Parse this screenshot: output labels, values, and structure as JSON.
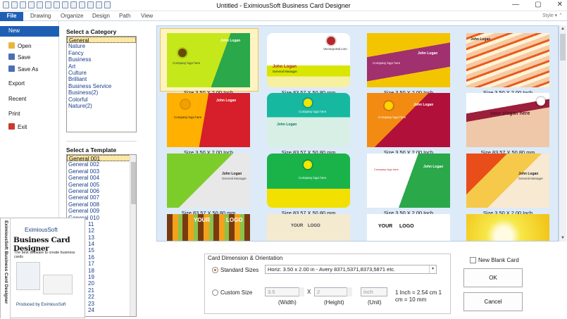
{
  "window": {
    "title": "Untitled - EximiousSoft Business Card Designer"
  },
  "ribbon": {
    "tabs": [
      "File",
      "Drawing",
      "Organize",
      "Design",
      "Path",
      "View"
    ],
    "style_label": "Style"
  },
  "file_menu": {
    "items": [
      "New",
      "Open",
      "Save",
      "Save As",
      "Export",
      "Recent",
      "Print",
      "Exit"
    ]
  },
  "categories": {
    "label": "Select a Category",
    "items": [
      "General",
      "Nature",
      "Fancy",
      "Business",
      "Art",
      "Culture",
      "Brilliant",
      "Business Service",
      "Business(2)",
      "Colorful",
      "Nature(2)"
    ],
    "selected": "General"
  },
  "templates": {
    "label": "Select a Template",
    "items": [
      "General 001",
      "General 002",
      "General 003",
      "General 004",
      "General 005",
      "General 006",
      "General 007",
      "General 008",
      "General 009",
      "General 010",
      "11",
      "12",
      "13",
      "14",
      "15",
      "16",
      "17",
      "18",
      "19",
      "20",
      "21",
      "22",
      "23",
      "24"
    ],
    "selected": "General 001"
  },
  "gallery": {
    "captions": [
      "Size 3.50 X 2.00 Inch",
      "Size 83.57 X 50.80 mm",
      "Size 3.50 X 2.00 Inch",
      "Size 3.50 X 2.00 Inch",
      "Size 3.50 X 2.00 Inch",
      "Size 83.57 X 50.80 mm",
      "Size 3.50 X 2.00 Inch",
      "Size 83.57 X 50.80 mm",
      "Size 83.57 X 50.80 mm",
      "Size 83.57 X 50.80 mm",
      "Size 3.50 X 2.00 Inch",
      "Size 3.50 X 2.00 Inch"
    ],
    "card_text": {
      "name": "John Logan",
      "role": "General Manager",
      "company": "Company logo here",
      "slogan": "your slogan here",
      "site": "Vectorportal.com",
      "your_logo": "YOUR",
      "logo": "LOGO"
    }
  },
  "options": {
    "group_title": "Card Dimension & Orientation",
    "standard_label": "Standard Sizes",
    "standard_value": "Horiz: 3.50 x 2.00 in - Avery 8371,5371,8373,5871 etc.",
    "custom_label": "Custom Size",
    "width_value": "3.5",
    "height_value": "2",
    "unit_value": "inch",
    "x_label": "X",
    "width_label": "(Width)",
    "height_label": "(Height)",
    "unit_label": "(Unit)",
    "conversion_line1": "1 Inch = 2.54 cm  1",
    "conversion_line2": "cm = 10 mm",
    "new_blank_label": "New Blank Card",
    "ok_label": "OK",
    "cancel_label": "Cancel"
  },
  "promo": {
    "brand": "EximiousSoft",
    "product": "Business Card Designer",
    "tagline": "The best software to create business cards",
    "producer": "Produced by EximiousSoft",
    "side_text": "EximiousSoft Business Card Designer"
  }
}
